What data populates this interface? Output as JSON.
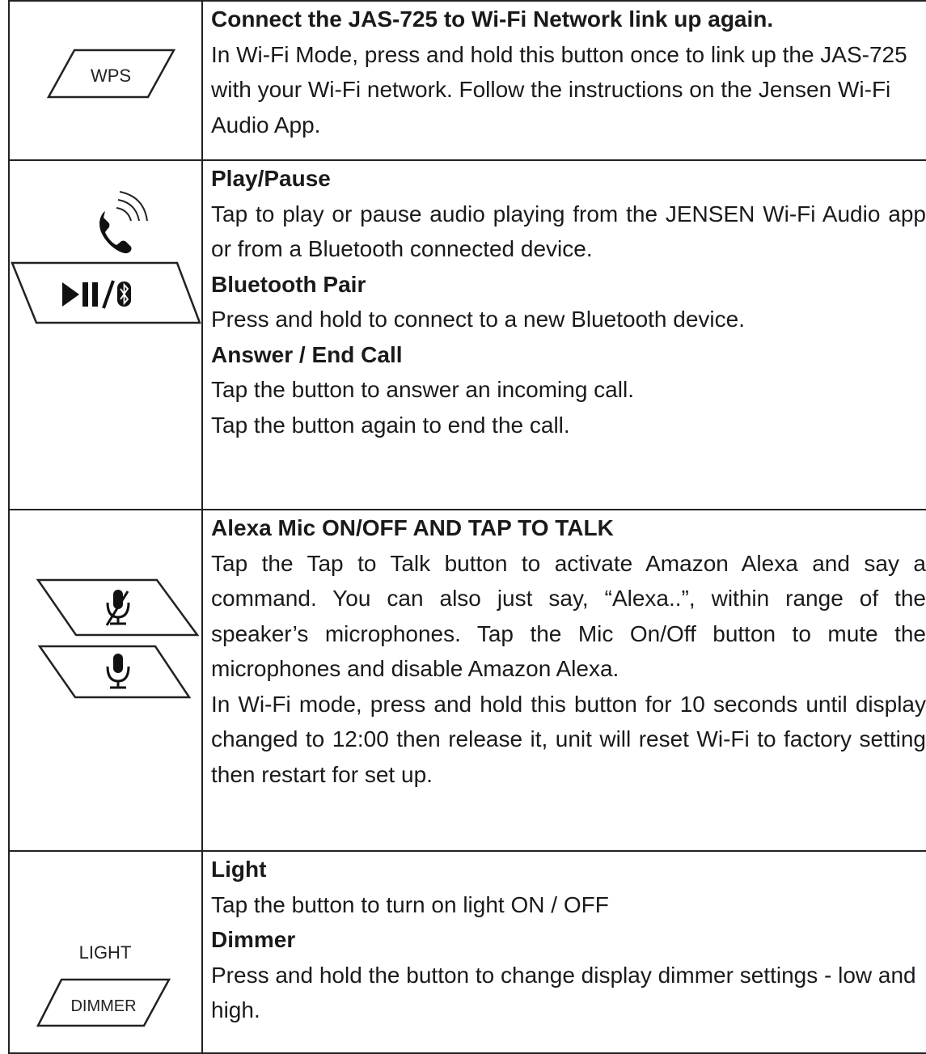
{
  "rows": [
    {
      "icon": "wps-button-icon",
      "icon_label": "WPS",
      "title": "Connect the JAS-725 to Wi-Fi Network link up again.",
      "body": "In Wi-Fi Mode, press and hold this button once to link up the JAS-725 with your Wi-Fi network. Follow the instructions on the Jensen Wi-Fi Audio App."
    },
    {
      "icon": "play-pause-bluetooth-phone-icon",
      "sections": [
        {
          "title": "Play/Pause",
          "body": "Tap to play or pause audio playing from the JENSEN Wi-Fi Audio app or from a Bluetooth connected device."
        },
        {
          "title": "Bluetooth Pair",
          "body": "Press and hold to connect to a new Bluetooth device."
        },
        {
          "title": "Answer / End Call",
          "body_lines": [
            "Tap the button to answer an incoming call.",
            "Tap the button again to end the call."
          ]
        }
      ]
    },
    {
      "icon": "mic-mute-and-mic-icon",
      "title": "Alexa Mic ON/OFF AND TAP TO TALK",
      "body": "Tap the Tap to Talk button to activate Amazon Alexa and say a command. You can also just say, “Alexa..”, within range of the speaker’s microphones. Tap the Mic On/Off button to mute the microphones and disable Amazon Alexa.",
      "body2": "In Wi-Fi mode, press and hold this button for 10 seconds until display changed to 12:00 then release it, unit will reset Wi-Fi to factory setting then restart for set up."
    },
    {
      "icon": "light-dimmer-button-icon",
      "icon_top_label": "LIGHT",
      "icon_label": "DIMMER",
      "sections": [
        {
          "title": "Light",
          "body": "Tap the button to turn on light ON / OFF"
        },
        {
          "title": "Dimmer",
          "body": "Press and hold the button to change display dimmer settings - low and high."
        }
      ]
    }
  ]
}
